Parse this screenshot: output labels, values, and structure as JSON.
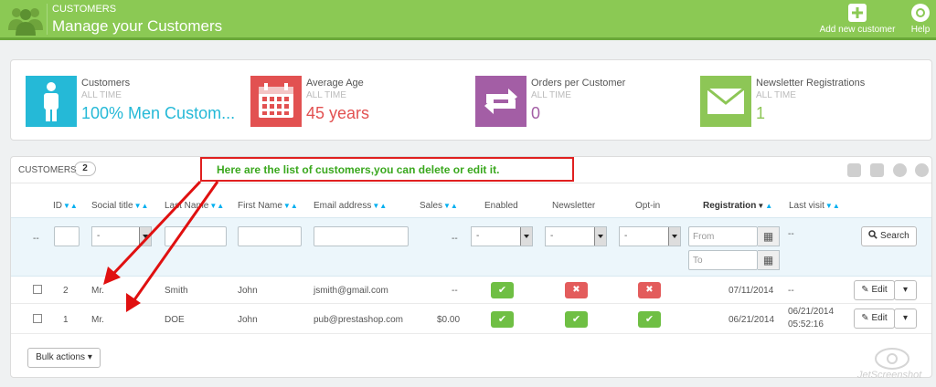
{
  "header": {
    "breadcrumb": "CUSTOMERS",
    "title": "Manage your Customers",
    "add_label": "Add new customer",
    "help_label": "Help"
  },
  "kpis": [
    {
      "title": "Customers",
      "sub": "ALL TIME",
      "value": "100% Men Custom...",
      "color": "#25b9d7",
      "icon": "person-icon"
    },
    {
      "title": "Average Age",
      "sub": "ALL TIME",
      "value": "45 years",
      "color": "#e25151",
      "icon": "calendar-icon"
    },
    {
      "title": "Orders per Customer",
      "sub": "ALL TIME",
      "value": "0",
      "color": "#a35ea5",
      "icon": "refresh-arrows-icon"
    },
    {
      "title": "Newsletter Registrations",
      "sub": "ALL TIME",
      "value": "1",
      "color": "#8dc656",
      "icon": "envelope-icon"
    }
  ],
  "panel": {
    "title": "CUSTOMERS",
    "count": "2",
    "annotation": "Here are the list of customers,you can delete or edit it."
  },
  "columns": {
    "id": "ID",
    "social_title": "Social title",
    "last_name": "Last Name",
    "first_name": "First Name",
    "email": "Email address",
    "sales": "Sales",
    "enabled": "Enabled",
    "newsletter": "Newsletter",
    "optin": "Opt-in",
    "registration": "Registration",
    "last_visit": "Last visit"
  },
  "filters": {
    "dash": "--",
    "select_default": "-",
    "from_placeholder": "From",
    "to_placeholder": "To",
    "search_label": "Search"
  },
  "rows": [
    {
      "id": "2",
      "social_title": "Mr.",
      "last_name": "Smith",
      "first_name": "John",
      "email": "jsmith@gmail.com",
      "sales": "--",
      "enabled": true,
      "newsletter": false,
      "optin": false,
      "registration": "07/11/2014",
      "last_visit": "--",
      "last_visit_time": "",
      "edit_label": "Edit"
    },
    {
      "id": "1",
      "social_title": "Mr.",
      "last_name": "DOE",
      "first_name": "John",
      "email": "pub@prestashop.com",
      "sales": "$0.00",
      "enabled": true,
      "newsletter": true,
      "optin": true,
      "registration": "06/21/2014",
      "last_visit": "06/21/2014",
      "last_visit_time": "05:52:16",
      "edit_label": "Edit"
    }
  ],
  "bulk_label": "Bulk actions",
  "watermark": "JetScreenshot"
}
